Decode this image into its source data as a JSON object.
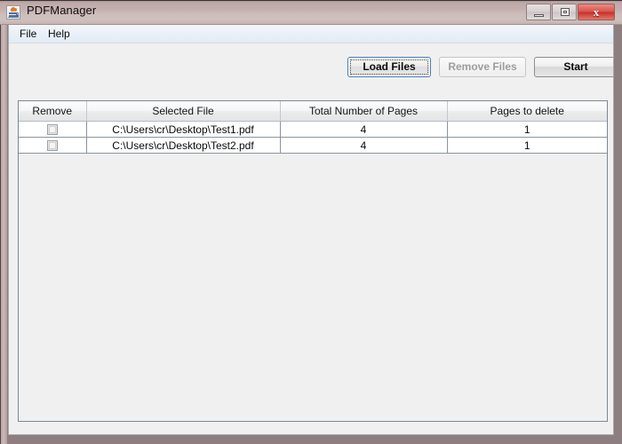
{
  "window": {
    "title": "PDFManager",
    "icon": "java-coffee-cup-icon",
    "controls": {
      "minimize": "minimize-icon",
      "maximize": "maximize-icon",
      "close": "x"
    }
  },
  "menu": {
    "items": [
      {
        "label": "File"
      },
      {
        "label": "Help"
      }
    ]
  },
  "toolbar": {
    "load_files_label": "Load Files",
    "remove_files_label": "Remove Files",
    "start_label": "Start"
  },
  "table": {
    "columns": [
      {
        "label": "Remove"
      },
      {
        "label": "Selected File"
      },
      {
        "label": "Total Number of Pages"
      },
      {
        "label": "Pages to delete"
      }
    ],
    "rows": [
      {
        "remove_checked": false,
        "selected_file": "C:\\Users\\cr\\Desktop\\Test1.pdf",
        "total_pages": "4",
        "pages_to_delete": "1"
      },
      {
        "remove_checked": false,
        "selected_file": "C:\\Users\\cr\\Desktop\\Test2.pdf",
        "total_pages": "4",
        "pages_to_delete": "1"
      }
    ]
  },
  "colors": {
    "frame": "#b59d9c",
    "titlebar_top": "#3a3032",
    "client_background": "#f0f0f0",
    "focus_border": "#4a7db5",
    "close_button": "#c6332a",
    "table_grid": "#8a959e",
    "disabled_text": "#9d9d9d"
  }
}
